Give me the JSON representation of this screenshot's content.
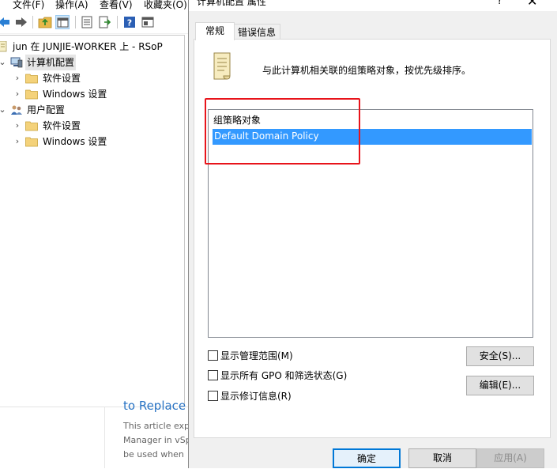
{
  "mmc": {
    "menu": [
      "文件(F)",
      "操作(A)",
      "查看(V)",
      "收藏夹(O)"
    ],
    "toolbar_icons": [
      "back-arrow-icon",
      "forward-arrow-icon",
      "up-folder-icon",
      "show-hide-tree-icon",
      "export-list-icon",
      "export-icon",
      "help-icon",
      "properties-icon"
    ],
    "tree": {
      "root": "jun 在 JUNJIE-WORKER 上 - RSoP",
      "computer_config": "计算机配置",
      "computer_children": [
        "软件设置",
        "Windows 设置"
      ],
      "user_config": "用户配置",
      "user_children": [
        "软件设置",
        "Windows 设置"
      ]
    }
  },
  "article": {
    "title": "to Replace",
    "lines": [
      "This article exp",
      "Manager in vSp",
      "be used when"
    ]
  },
  "dialog": {
    "title": "计算机配置 属性",
    "help": "?",
    "close": "✕",
    "tabs": [
      "常规",
      "错误信息"
    ],
    "description": "与此计算机相关联的组策略对象，按优先级排序。",
    "list_header": "组策略对象",
    "list_items": [
      "Default Domain Policy"
    ],
    "checkboxes": [
      "显示管理范围(M)",
      "显示所有 GPO 和筛选状态(G)",
      "显示修订信息(R)"
    ],
    "security_button": "安全(S)...",
    "edit_button": "编辑(E)...",
    "ok_button": "确定",
    "cancel_button": "取消",
    "apply_button": "应用(A)"
  },
  "colors": {
    "selection": "#3399ff",
    "highlight_box": "#e8141b",
    "link": "#2873c4"
  }
}
